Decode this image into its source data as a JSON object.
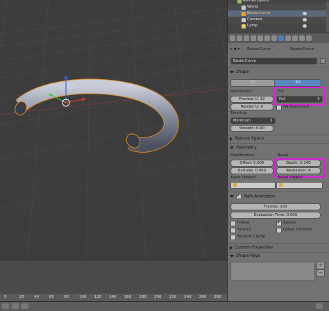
{
  "outliner": {
    "items": [
      {
        "label": "RenderLayers",
        "highlight": false
      },
      {
        "label": "World",
        "highlight": false
      },
      {
        "label": "BezierCurve",
        "highlight": true
      },
      {
        "label": "Camera",
        "highlight": false
      },
      {
        "label": "Lamp",
        "highlight": false
      }
    ]
  },
  "properties": {
    "breadcrumb": {
      "object": "BezierCurve",
      "data": "BezierCurve"
    },
    "datablock_name": "BezierCurve",
    "shape": {
      "header": "Shape",
      "btn_2d": "2D",
      "btn_3d": "3D",
      "resolution_label": "Resolution:",
      "preview_u": "Preview U: 12",
      "render_u": "Render U: 0",
      "fill_label": "Fill:",
      "fill_value": "Full",
      "fill_deformed": "Fill Deformed",
      "twisting_label": "Twisting:",
      "twisting_value": "Minimum",
      "smooth": "Smooth: 0.00"
    },
    "texture_space_header": "Texture Space",
    "geometry": {
      "header": "Geometry",
      "modification_label": "Modification:",
      "offset": "Offset: 0.000",
      "extrude": "Extrude: 0.000",
      "bevel_label": "Bevel:",
      "depth": "Depth: 0.140",
      "resolution": "Resolution: 6",
      "taper_label": "Taper Object:",
      "bevel_object_label": "Bevel Object:"
    },
    "path_animation": {
      "header": "Path Animation",
      "frames": "Frames: 100",
      "evaluation_time": "Evaluation Time: 0.000",
      "follow": "Follow",
      "radius": "Radius",
      "stretch": "Stretch",
      "offset_children": "Offset Children",
      "bounds_clamp": "Bounds Clamp"
    },
    "custom_properties_header": "Custom Properties",
    "shape_keys_header": "Shape Keys"
  },
  "timeline": {
    "frames": [
      "0",
      "20",
      "40",
      "60",
      "80",
      "100",
      "120",
      "140",
      "160",
      "180",
      "200",
      "220",
      "240",
      "260",
      "280"
    ]
  },
  "colors": {
    "highlight_box": "#e020e0",
    "selected_outline": "#e08a1e",
    "active_tab": "#4e7fb8"
  }
}
